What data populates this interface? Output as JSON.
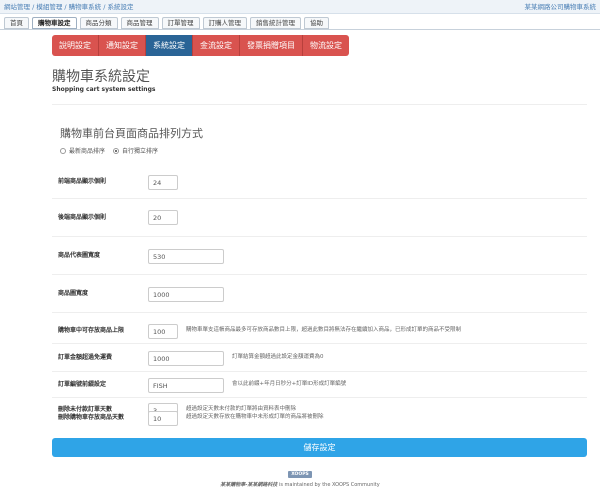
{
  "top": {
    "breadcrumb": "網站管理 / 模組管理 / 購物車系統 / 系統設定",
    "site": "某某網路公司購物車系統"
  },
  "menu": [
    {
      "label": "首頁"
    },
    {
      "label": "購物車設定"
    },
    {
      "label": "商品分類"
    },
    {
      "label": "商品管理"
    },
    {
      "label": "訂單管理"
    },
    {
      "label": "訂購人管理"
    },
    {
      "label": "銷售統計管理"
    },
    {
      "label": "協助"
    }
  ],
  "tabs": [
    {
      "label": "說明設定"
    },
    {
      "label": "通知設定"
    },
    {
      "label": "系統設定"
    },
    {
      "label": "金流設定"
    },
    {
      "label": "發票捐贈項目"
    },
    {
      "label": "物流設定"
    }
  ],
  "page": {
    "title": "購物車系統設定",
    "subtitle": "Shopping cart system settings"
  },
  "section": {
    "title": "購物車前台頁面商品排列方式",
    "option_newest": "最新商品排序",
    "option_custom": "自行獨立排序",
    "selected": "custom"
  },
  "fields": {
    "front_count": {
      "label": "前端商品顯示個則",
      "value": "24"
    },
    "back_count": {
      "label": "後端商品顯示個則",
      "value": "20"
    },
    "thumb_width": {
      "label": "商品代表圖寬度",
      "value": "530"
    },
    "image_width": {
      "label": "商品圖寬度",
      "value": "1000"
    },
    "cart_limit": {
      "label": "購物車中可存放商品上限",
      "value": "100",
      "help": "購物車單支這帳商品最多可存放商品數目上限，超過此數目將無法存在繼續加入商品，已形成訂單的商品不受限制"
    },
    "free_shipping": {
      "label": "訂單金額超過免運費",
      "value": "1000",
      "help": "訂單結算金額超過此設定金額運費為0"
    },
    "order_prefix": {
      "label": "訂單編號前綴設定",
      "value": "FISH",
      "help": "會以此前綴+年月日秒分+訂單ID形成訂單編號"
    },
    "unpaid_days": {
      "label": "刪除未付款訂單天數",
      "value": "3",
      "help": "超過設定天數未付款的訂單將由資料表中刪除"
    },
    "cart_days": {
      "label": "刪除購物車存放商品天數",
      "value": "10",
      "help": "超過設定天數存放在購物車中未形成訂單的商品將被刪除"
    }
  },
  "save_label": "儲存設定",
  "footer": {
    "badge": "XOOPS",
    "site_name": "某某購物車-某某網路科技",
    "maintained": "is maintained by the XOOPS Community"
  }
}
